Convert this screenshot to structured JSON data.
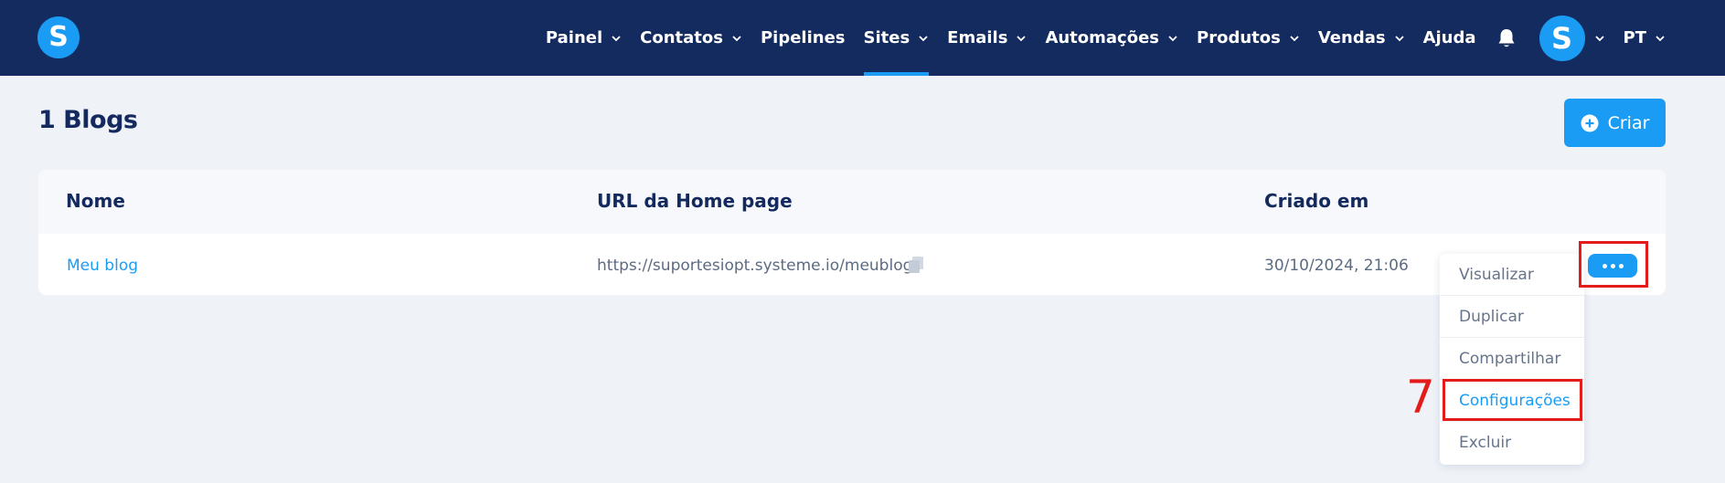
{
  "nav": {
    "logo": "S",
    "items": [
      {
        "label": "Painel",
        "has_dropdown": true
      },
      {
        "label": "Contatos",
        "has_dropdown": true
      },
      {
        "label": "Pipelines",
        "has_dropdown": false
      },
      {
        "label": "Sites",
        "has_dropdown": true,
        "active": true
      },
      {
        "label": "Emails",
        "has_dropdown": true
      },
      {
        "label": "Automações",
        "has_dropdown": true
      },
      {
        "label": "Produtos",
        "has_dropdown": true
      },
      {
        "label": "Vendas",
        "has_dropdown": true
      },
      {
        "label": "Ajuda",
        "has_dropdown": false
      }
    ],
    "avatar_letter": "S",
    "language": "PT"
  },
  "page": {
    "title": "1 Blogs",
    "create_label": "Criar"
  },
  "table": {
    "headers": [
      "Nome",
      "URL da Home page",
      "Criado em"
    ],
    "rows": [
      {
        "name": "Meu blog",
        "url": "https://suportesiopt.systeme.io/meublog",
        "created": "30/10/2024, 21:06"
      }
    ]
  },
  "menu": {
    "items": [
      "Visualizar",
      "Duplicar",
      "Compartilhar",
      "Configurações",
      "Excluir"
    ],
    "highlighted": "Configurações"
  },
  "annotation": {
    "step_number": "7",
    "color": "#e41b1b"
  },
  "colors": {
    "nav_bg": "#142b5f",
    "accent": "#1a9cf5",
    "page_bg": "#eff3f8"
  }
}
